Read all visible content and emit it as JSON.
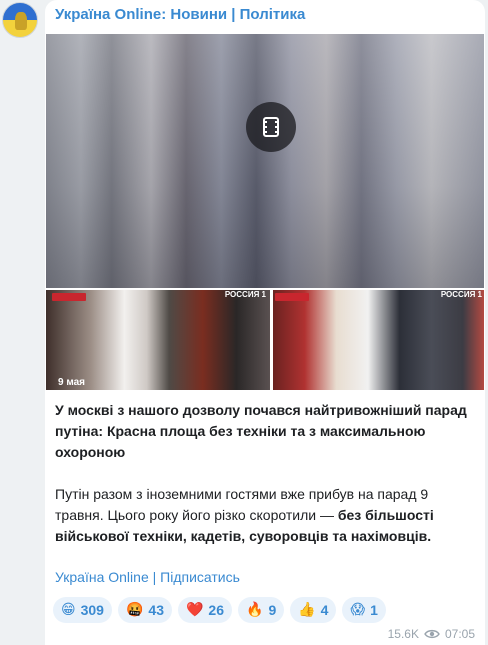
{
  "channel": {
    "name": "Україна Online: Новини | Політика"
  },
  "media": {
    "video_icon": "film-icon",
    "photo_left_badge": "РОССИЯ 1",
    "photo_left_caption": "9 мая",
    "photo_right_badge": "РОССИЯ 1"
  },
  "post": {
    "headline": "У москві з нашого дозволу почався найтривожніший парад путіна: Красна площа без техніки та з максимальною охороною",
    "body_plain": "Путін разом з іноземними гостями вже прибув на парад 9 травня. Цього року його різко скоротили — ",
    "body_bold": "без більшості військової техніки, кадетів, суворовців та нахімовців."
  },
  "links": {
    "channel_link": "Україна Online",
    "separator": " | ",
    "subscribe": "Підписатись"
  },
  "reactions": [
    {
      "emoji": "😁",
      "count": "309"
    },
    {
      "emoji": "🤬",
      "count": "43"
    },
    {
      "emoji": "❤️",
      "count": "26"
    },
    {
      "emoji": "🔥",
      "count": "9"
    },
    {
      "emoji": "👍",
      "count": "4"
    },
    {
      "emoji": "😱",
      "count": "1"
    }
  ],
  "meta": {
    "views": "15.6K",
    "time": "07:05"
  },
  "colors": {
    "accent": "#3a8ad1",
    "reaction_bg": "#e9f2fb",
    "page_bg": "#eef1f3"
  }
}
